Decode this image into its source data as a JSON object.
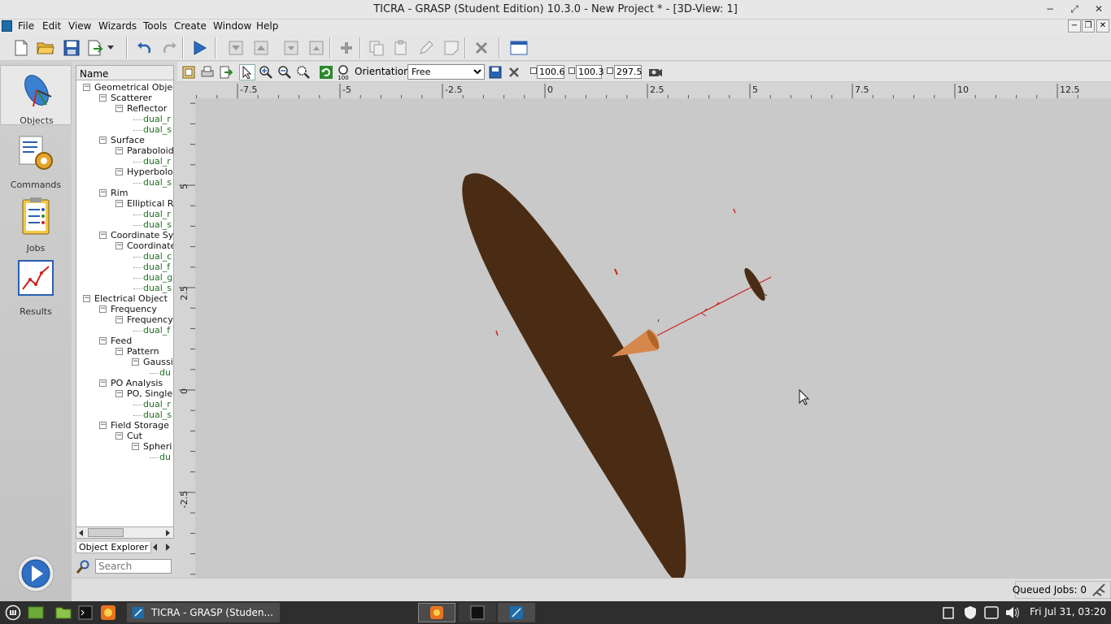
{
  "window": {
    "title": "TICRA - GRASP (Student Edition) 10.3.0 - New Project * - [3D-View: 1]",
    "controls": [
      "−",
      "⤢",
      "✕"
    ]
  },
  "menu": {
    "items": [
      "File",
      "Edit",
      "View",
      "Wizards",
      "Tools",
      "Create",
      "Window",
      "Help"
    ]
  },
  "sidebar": {
    "items": [
      {
        "label": "Objects",
        "icon": "satellite-dish-icon"
      },
      {
        "label": "Commands",
        "icon": "commands-gear-icon"
      },
      {
        "label": "Jobs",
        "icon": "clipboard-icon"
      },
      {
        "label": "Results",
        "icon": "chart-icon"
      }
    ],
    "run_icon": "play-icon"
  },
  "explorer": {
    "header": "Name",
    "tree": [
      {
        "label": "Geometrical Objec",
        "level": 0,
        "leaf": false
      },
      {
        "label": "Scatterer",
        "level": 1,
        "leaf": false
      },
      {
        "label": "Reflector",
        "level": 2,
        "leaf": false
      },
      {
        "label": "dual_r",
        "level": 3,
        "leaf": true
      },
      {
        "label": "dual_s",
        "level": 3,
        "leaf": true
      },
      {
        "label": "Surface",
        "level": 1,
        "leaf": false
      },
      {
        "label": "Paraboloid",
        "level": 2,
        "leaf": false
      },
      {
        "label": "dual_r",
        "level": 3,
        "leaf": true
      },
      {
        "label": "Hyperboloi",
        "level": 2,
        "leaf": false
      },
      {
        "label": "dual_s",
        "level": 3,
        "leaf": true
      },
      {
        "label": "Rim",
        "level": 1,
        "leaf": false
      },
      {
        "label": "Elliptical R",
        "level": 2,
        "leaf": false
      },
      {
        "label": "dual_r",
        "level": 3,
        "leaf": true
      },
      {
        "label": "dual_s",
        "level": 3,
        "leaf": true
      },
      {
        "label": "Coordinate Sys",
        "level": 1,
        "leaf": false
      },
      {
        "label": "Coordinate",
        "level": 2,
        "leaf": false
      },
      {
        "label": "dual_c",
        "level": 3,
        "leaf": true
      },
      {
        "label": "dual_f",
        "level": 3,
        "leaf": true
      },
      {
        "label": "dual_g",
        "level": 3,
        "leaf": true
      },
      {
        "label": "dual_s",
        "level": 3,
        "leaf": true
      },
      {
        "label": "Electrical Object",
        "level": 0,
        "leaf": false
      },
      {
        "label": "Frequency",
        "level": 1,
        "leaf": false
      },
      {
        "label": "Frequency",
        "level": 2,
        "leaf": false
      },
      {
        "label": "dual_f",
        "level": 3,
        "leaf": true
      },
      {
        "label": "Feed",
        "level": 1,
        "leaf": false
      },
      {
        "label": "Pattern",
        "level": 2,
        "leaf": false
      },
      {
        "label": "Gaussi",
        "level": 3,
        "leaf": false
      },
      {
        "label": "du",
        "level": 4,
        "leaf": true
      },
      {
        "label": "PO Analysis",
        "level": 1,
        "leaf": false
      },
      {
        "label": "PO, Single",
        "level": 2,
        "leaf": false
      },
      {
        "label": "dual_r",
        "level": 3,
        "leaf": true
      },
      {
        "label": "dual_s",
        "level": 3,
        "leaf": true
      },
      {
        "label": "Field Storage",
        "level": 1,
        "leaf": false
      },
      {
        "label": "Cut",
        "level": 2,
        "leaf": false
      },
      {
        "label": "Spheri",
        "level": 3,
        "leaf": false
      },
      {
        "label": "du",
        "level": 4,
        "leaf": true
      }
    ],
    "tab_label": "Object Explorer",
    "search_placeholder": "Search"
  },
  "view_toolbar": {
    "orientation_label": "Orientation:",
    "orientation_value": "Free",
    "field1": "100.6",
    "field2": "100.3",
    "field3": "297.5"
  },
  "ruler": {
    "x_labels": [
      "-7.5",
      "-5",
      "-2.5",
      "0",
      "2.5",
      "5",
      "7.5",
      "10",
      "12.5"
    ],
    "y_labels": [
      "5",
      "2.5",
      "0",
      "-2.5"
    ]
  },
  "status": {
    "queued_jobs": "Queued Jobs: 0"
  },
  "taskbar": {
    "active_window": "TICRA - GRASP (Studen...",
    "clock": "Fri Jul 31, 03:20"
  },
  "colors": {
    "reflector": "#4a2c14",
    "feed_cone": "#c9773a",
    "beam": "#cc2222",
    "viewport": "#c9c9c9"
  }
}
